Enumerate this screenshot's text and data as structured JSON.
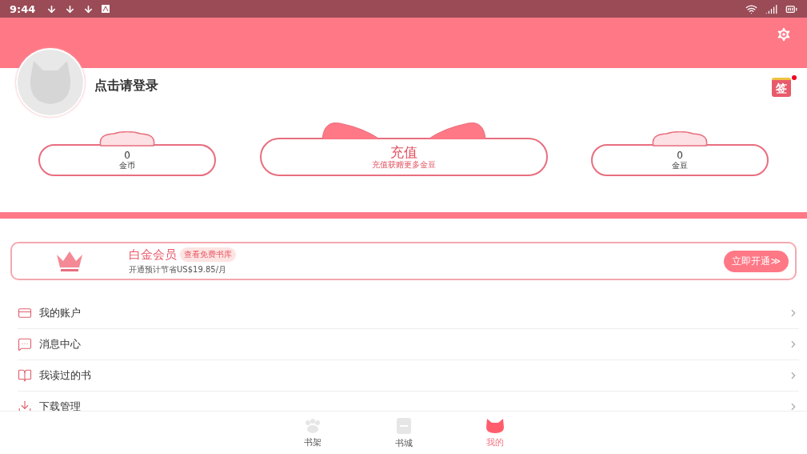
{
  "status_bar": {
    "time": "9:44"
  },
  "profile": {
    "login_text": "点击请登录",
    "sign_in": {
      "label": "签",
      "badge": true
    }
  },
  "stats": [
    {
      "kind": "small",
      "value": "0",
      "label": "金币"
    },
    {
      "kind": "large",
      "value": "充值",
      "label": "充值获赠更多金豆"
    },
    {
      "kind": "small",
      "value": "0",
      "label": "金豆"
    }
  ],
  "vip": {
    "title": "白金会员",
    "tag": "查看免费书库",
    "subtitle": "开通预计节省US$19.85/月",
    "button": "立即开通≫"
  },
  "menu": [
    {
      "kind": "card",
      "label": "我的账户"
    },
    {
      "kind": "message",
      "label": "消息中心"
    },
    {
      "kind": "book",
      "label": "我读过的书"
    },
    {
      "kind": "download",
      "label": "下载管理"
    }
  ],
  "tabs": [
    {
      "kind": "paw",
      "label": "书架",
      "selected": false
    },
    {
      "kind": "store",
      "label": "书城",
      "selected": false
    },
    {
      "kind": "cat",
      "label": "我的",
      "selected": true
    }
  ]
}
